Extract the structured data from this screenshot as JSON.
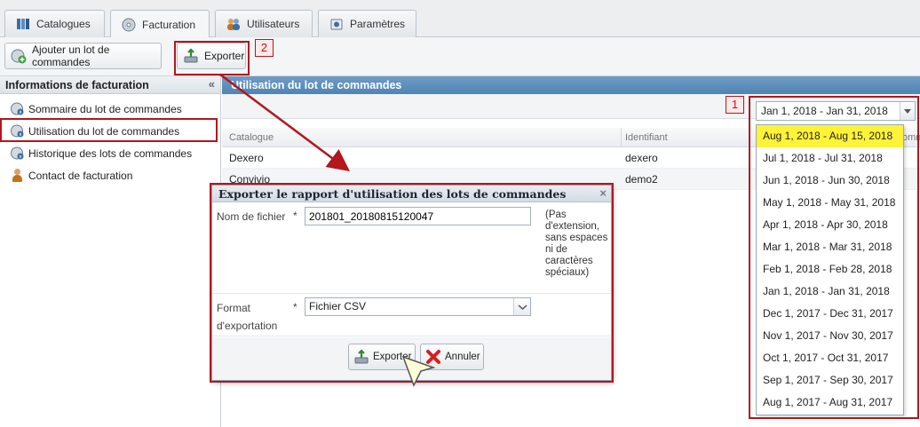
{
  "tabs": [
    {
      "label": "Catalogues",
      "icon": "book-icon"
    },
    {
      "label": "Facturation",
      "icon": "disk-icon",
      "active": true
    },
    {
      "label": "Utilisateurs",
      "icon": "users-icon"
    },
    {
      "label": "Paramètres",
      "icon": "settings-icon"
    }
  ],
  "toolbar": {
    "add_batch_label": "Ajouter un lot de commandes",
    "export_label": "Exporter"
  },
  "left_panel": {
    "title": "Informations de facturation",
    "collapse_glyph": "«",
    "items": [
      {
        "label": "Sommaire du lot de commandes",
        "icon": "info-disk-icon"
      },
      {
        "label": "Utilisation du lot de commandes",
        "icon": "info-disk-icon",
        "selected": true
      },
      {
        "label": "Historique des lots de commandes",
        "icon": "info-disk-icon"
      },
      {
        "label": "Contact de facturation",
        "icon": "person-icon"
      }
    ]
  },
  "main": {
    "title": "Utilisation du lot de commandes",
    "date_filter": {
      "value": "Jan 1, 2018 - Jan 31, 2018",
      "options": [
        "Aug 1, 2018 - Aug 15, 2018",
        "Jul 1, 2018 - Jul 31, 2018",
        "Jun 1, 2018 - Jun 30, 2018",
        "May 1, 2018 - May 31, 2018",
        "Apr 1, 2018 - Apr 30, 2018",
        "Mar 1, 2018 - Mar 31, 2018",
        "Feb 1, 2018 - Feb 28, 2018",
        "Jan 1, 2018 - Jan 31, 2018",
        "Dec 1, 2017 - Dec 31, 2017",
        "Nov 1, 2017 - Nov 30, 2017",
        "Oct 1, 2017 - Oct 31, 2017",
        "Sep 1, 2017 - Sep 30, 2017",
        "Aug 1, 2017 - Aug 31, 2017"
      ],
      "highlighted_option": "Aug 1, 2018 - Aug 15, 2018"
    },
    "grid": {
      "columns": [
        "Catalogue",
        "Identifiant",
        "omm"
      ],
      "rows": [
        {
          "catalogue": "Dexero",
          "identifiant": "dexero"
        },
        {
          "catalogue": "Convivio",
          "identifiant": "demo2"
        }
      ]
    }
  },
  "dialog": {
    "title": "Exporter le rapport d'utilisation des lots de commandes",
    "close_glyph": "×",
    "filename_label": "Nom de fichier",
    "filename_value": "201801_20180815120047",
    "filename_help": "(Pas d'extension, sans espaces ni de caractères spéciaux)",
    "required_mark": "*",
    "format_label": "Format d'exportation",
    "format_value": "Fichier CSV",
    "export_label": "Exporter",
    "cancel_label": "Annuler"
  },
  "annotations": {
    "badge_1": "1",
    "badge_2": "2",
    "highlight_color": "#b3161d"
  },
  "colors": {
    "header_blue": "#5a8cba",
    "selected_option": "#fff33a"
  }
}
